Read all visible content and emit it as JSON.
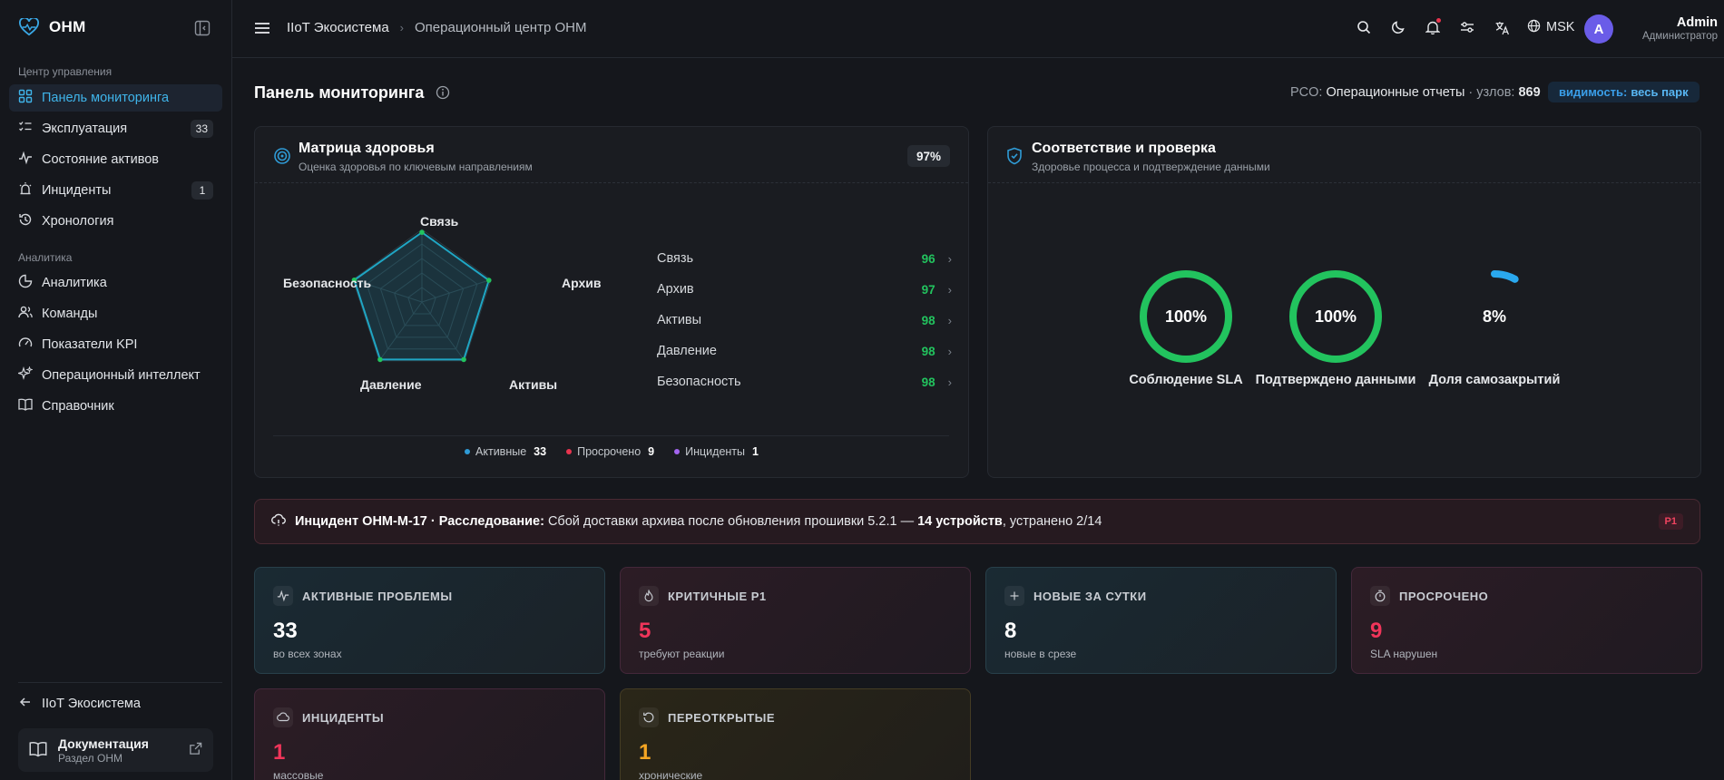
{
  "brand": {
    "name": "OHM"
  },
  "sidebar": {
    "section1": "Центр управления",
    "section2": "Аналитика",
    "items": [
      {
        "label": "Панель мониторинга"
      },
      {
        "label": "Эксплуатация",
        "badge": "33"
      },
      {
        "label": "Состояние активов"
      },
      {
        "label": "Инциденты",
        "badge": "1"
      },
      {
        "label": "Хронология"
      },
      {
        "label": "Аналитика"
      },
      {
        "label": "Команды"
      },
      {
        "label": "Показатели KPI"
      },
      {
        "label": "Операционный интеллект"
      },
      {
        "label": "Справочник"
      }
    ],
    "back_label": "IIoT Экосистема",
    "doc": {
      "title": "Документация",
      "subtitle": "Раздел OHM"
    }
  },
  "topbar": {
    "crumb1": "IIoT Экосистема",
    "crumb_sep": "›",
    "crumb2": "Операционный центр OHM",
    "timezone": "MSK",
    "user": {
      "initial": "A",
      "name": "Admin",
      "role": "Администратор"
    }
  },
  "page": {
    "title": "Панель мониторинга",
    "meta_prefix": "PCO: ",
    "meta_report": "Операционные отчеты",
    "meta_nodes": " · узлов: ",
    "meta_count": "869",
    "vis_label": "видимость:",
    "vis_value": "весь парк"
  },
  "health": {
    "title": "Матрица здоровья",
    "subtitle": "Оценка здоровья по ключевым направлениям",
    "score": "97%",
    "metrics": [
      {
        "label": "Связь",
        "value": 96
      },
      {
        "label": "Архив",
        "value": 97
      },
      {
        "label": "Активы",
        "value": 98
      },
      {
        "label": "Давление",
        "value": 98
      },
      {
        "label": "Безопасность",
        "value": 98
      }
    ],
    "legend": [
      {
        "label": "Активные",
        "value": "33",
        "color": "#2f9bd6"
      },
      {
        "label": "Просрочено",
        "value": "9",
        "color": "#e8344e"
      },
      {
        "label": "Инциденты",
        "value": "1",
        "color": "#a365f0"
      }
    ]
  },
  "compliance": {
    "title": "Соответствие и проверка",
    "subtitle": "Здоровье процесса и подтверждение данными",
    "gauges": [
      {
        "value": "100%",
        "label": "Соблюдение SLA",
        "fraction": 1.0,
        "color": "#22c35e"
      },
      {
        "value": "100%",
        "label": "Подтверждено данными",
        "fraction": 1.0,
        "color": "#22c35e"
      },
      {
        "value": "8%",
        "label": "Доля самозакрытий",
        "fraction": 0.08,
        "color": "#2aa8ee"
      }
    ]
  },
  "alert": {
    "lead": "Инцидент OHM-M-17 · Расследование:",
    "text": " Сбой доставки архива после обновления прошивки 5.2.1 — ",
    "devices": "14 устройств",
    "tail": ", устранено 2/14",
    "priority": "P1"
  },
  "stats": [
    {
      "label": "АКТИВНЫЕ ПРОБЛЕМЫ",
      "value": "33",
      "sub": "во всех зонах",
      "color": "#ffffff",
      "icon": "pulse-icon"
    },
    {
      "label": "КРИТИЧНЫЕ P1",
      "value": "5",
      "sub": "требуют реакции",
      "color": "#f0355a",
      "icon": "flame-icon"
    },
    {
      "label": "НОВЫЕ ЗА СУТКИ",
      "value": "8",
      "sub": "новые в срезе",
      "color": "#ffffff",
      "icon": "plus-icon"
    },
    {
      "label": "ПРОСРОЧЕНО",
      "value": "9",
      "sub": "SLA нарушен",
      "color": "#f0355a",
      "icon": "timer-icon"
    },
    {
      "label": "ИНЦИДЕНТЫ",
      "value": "1",
      "sub": "массовые",
      "color": "#f0355a",
      "icon": "cloud-icon"
    },
    {
      "label": "ПЕРЕОТКРЫТЫЕ",
      "value": "1",
      "sub": "хронические",
      "color": "#f5a623",
      "icon": "reopen-icon"
    }
  ]
}
